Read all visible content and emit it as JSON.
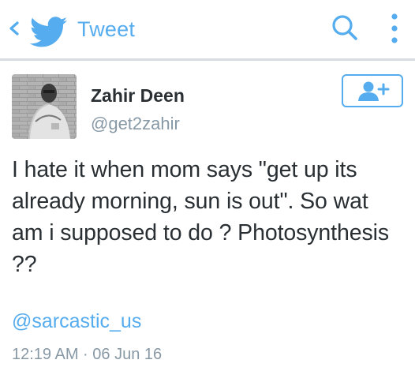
{
  "header": {
    "title": "Tweet",
    "back_icon": "chevron-left-icon",
    "logo_icon": "twitter-bird-icon",
    "search_icon": "search-icon",
    "more_icon": "more-vertical-icon",
    "accent_color": "#55acee"
  },
  "tweet": {
    "author_name": "Zahir Deen",
    "author_handle": "@get2zahir",
    "follow_icon": "follow-user-icon",
    "text": "I hate it when mom says \"get up its\nalready morning, sun is out\". So wat\nam i supposed to do ? Photosynthesis\n??",
    "mention": "@sarcastic_us",
    "timestamp": "12:19 AM · 06 Jun 16"
  }
}
